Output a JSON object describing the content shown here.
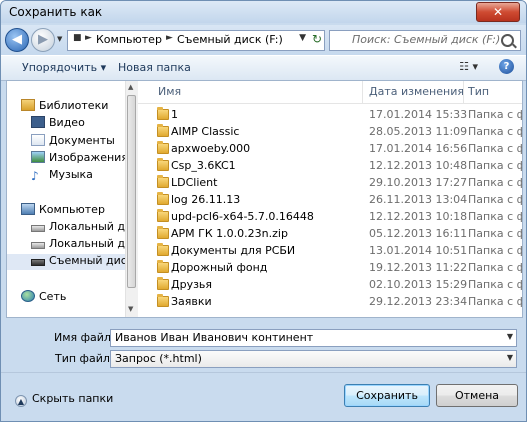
{
  "window": {
    "title": "Сохранить как",
    "close_label": "✕"
  },
  "address": {
    "crumbs": [
      "Компьютер",
      "Съемный диск (F:)"
    ],
    "search_placeholder": "Поиск: Съемный диск (F:)"
  },
  "toolbar": {
    "organize_label": "Упорядочить ▾",
    "new_folder_label": "Новая папка"
  },
  "sidebar": {
    "items": [
      {
        "label": "Библиотеки",
        "icon": "library-icon"
      },
      {
        "label": "Видео",
        "icon": "video-icon"
      },
      {
        "label": "Документы",
        "icon": "documents-icon"
      },
      {
        "label": "Изображения",
        "icon": "pictures-icon"
      },
      {
        "label": "Музыка",
        "icon": "music-icon"
      },
      {
        "label": "Компьютер",
        "icon": "computer-icon"
      },
      {
        "label": "Локальный диск",
        "icon": "drive-icon"
      },
      {
        "label": "Локальный диск",
        "icon": "drive-icon"
      },
      {
        "label": "Съемный диск (",
        "icon": "removable-drive-icon"
      },
      {
        "label": "Сеть",
        "icon": "network-icon"
      }
    ]
  },
  "columns": {
    "name": "Имя",
    "date": "Дата изменения",
    "type": "Тип"
  },
  "files": [
    {
      "name": "1",
      "date": "17.01.2014 15:33",
      "type": "Папка с ф"
    },
    {
      "name": "AIMP Classic",
      "date": "28.05.2013 11:09",
      "type": "Папка с ф"
    },
    {
      "name": "apxwoeby.000",
      "date": "17.01.2014 16:56",
      "type": "Папка с ф"
    },
    {
      "name": "Csp_3.6KC1",
      "date": "12.12.2013 10:48",
      "type": "Папка с ф"
    },
    {
      "name": "LDClient",
      "date": "29.10.2013 17:27",
      "type": "Папка с ф"
    },
    {
      "name": "log 26.11.13",
      "date": "26.11.2013 13:04",
      "type": "Папка с ф"
    },
    {
      "name": "upd-pcl6-x64-5.7.0.16448",
      "date": "12.12.2013 10:18",
      "type": "Папка с ф"
    },
    {
      "name": "АРМ ГК 1.0.0.23n.zip",
      "date": "05.12.2013 16:11",
      "type": "Папка с ф"
    },
    {
      "name": "Документы для РСБИ",
      "date": "13.01.2014 10:51",
      "type": "Папка с ф"
    },
    {
      "name": "Дорожный фонд",
      "date": "19.12.2013 11:22",
      "type": "Папка с ф"
    },
    {
      "name": "Друзья",
      "date": "02.10.2013 15:29",
      "type": "Папка с ф"
    },
    {
      "name": "Заявки",
      "date": "29.12.2013 23:34",
      "type": "Папка с ф"
    }
  ],
  "form": {
    "filename_label": "Имя файла:",
    "filename_value": "Иванов Иван Иванович континент",
    "filetype_label": "Тип файла:",
    "filetype_value": "Запрос (*.html)"
  },
  "footer": {
    "hide_folders_label": "Скрыть папки",
    "save_label": "Сохранить",
    "cancel_label": "Отмена"
  },
  "colors": {
    "accent": "#1e395b",
    "window_bg": "#c9dbee",
    "selection": "#dfe8f5"
  }
}
